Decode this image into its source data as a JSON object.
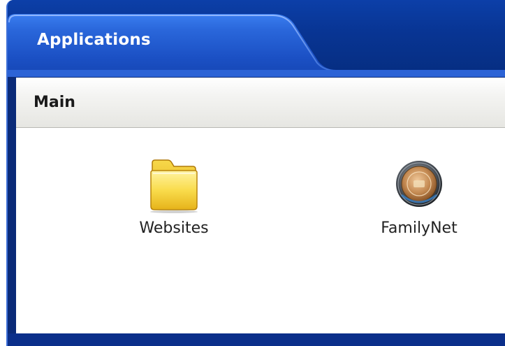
{
  "window": {
    "title": "Applications"
  },
  "section": {
    "title": "Main"
  },
  "apps": [
    {
      "label": "Websites",
      "icon": "folder-icon"
    },
    {
      "label": "FamilyNet",
      "icon": "familynet-seal-icon"
    }
  ],
  "colors": {
    "titlebar": "#083594",
    "tab_highlight": "#2f6ee0",
    "folder": "#f2c524"
  }
}
